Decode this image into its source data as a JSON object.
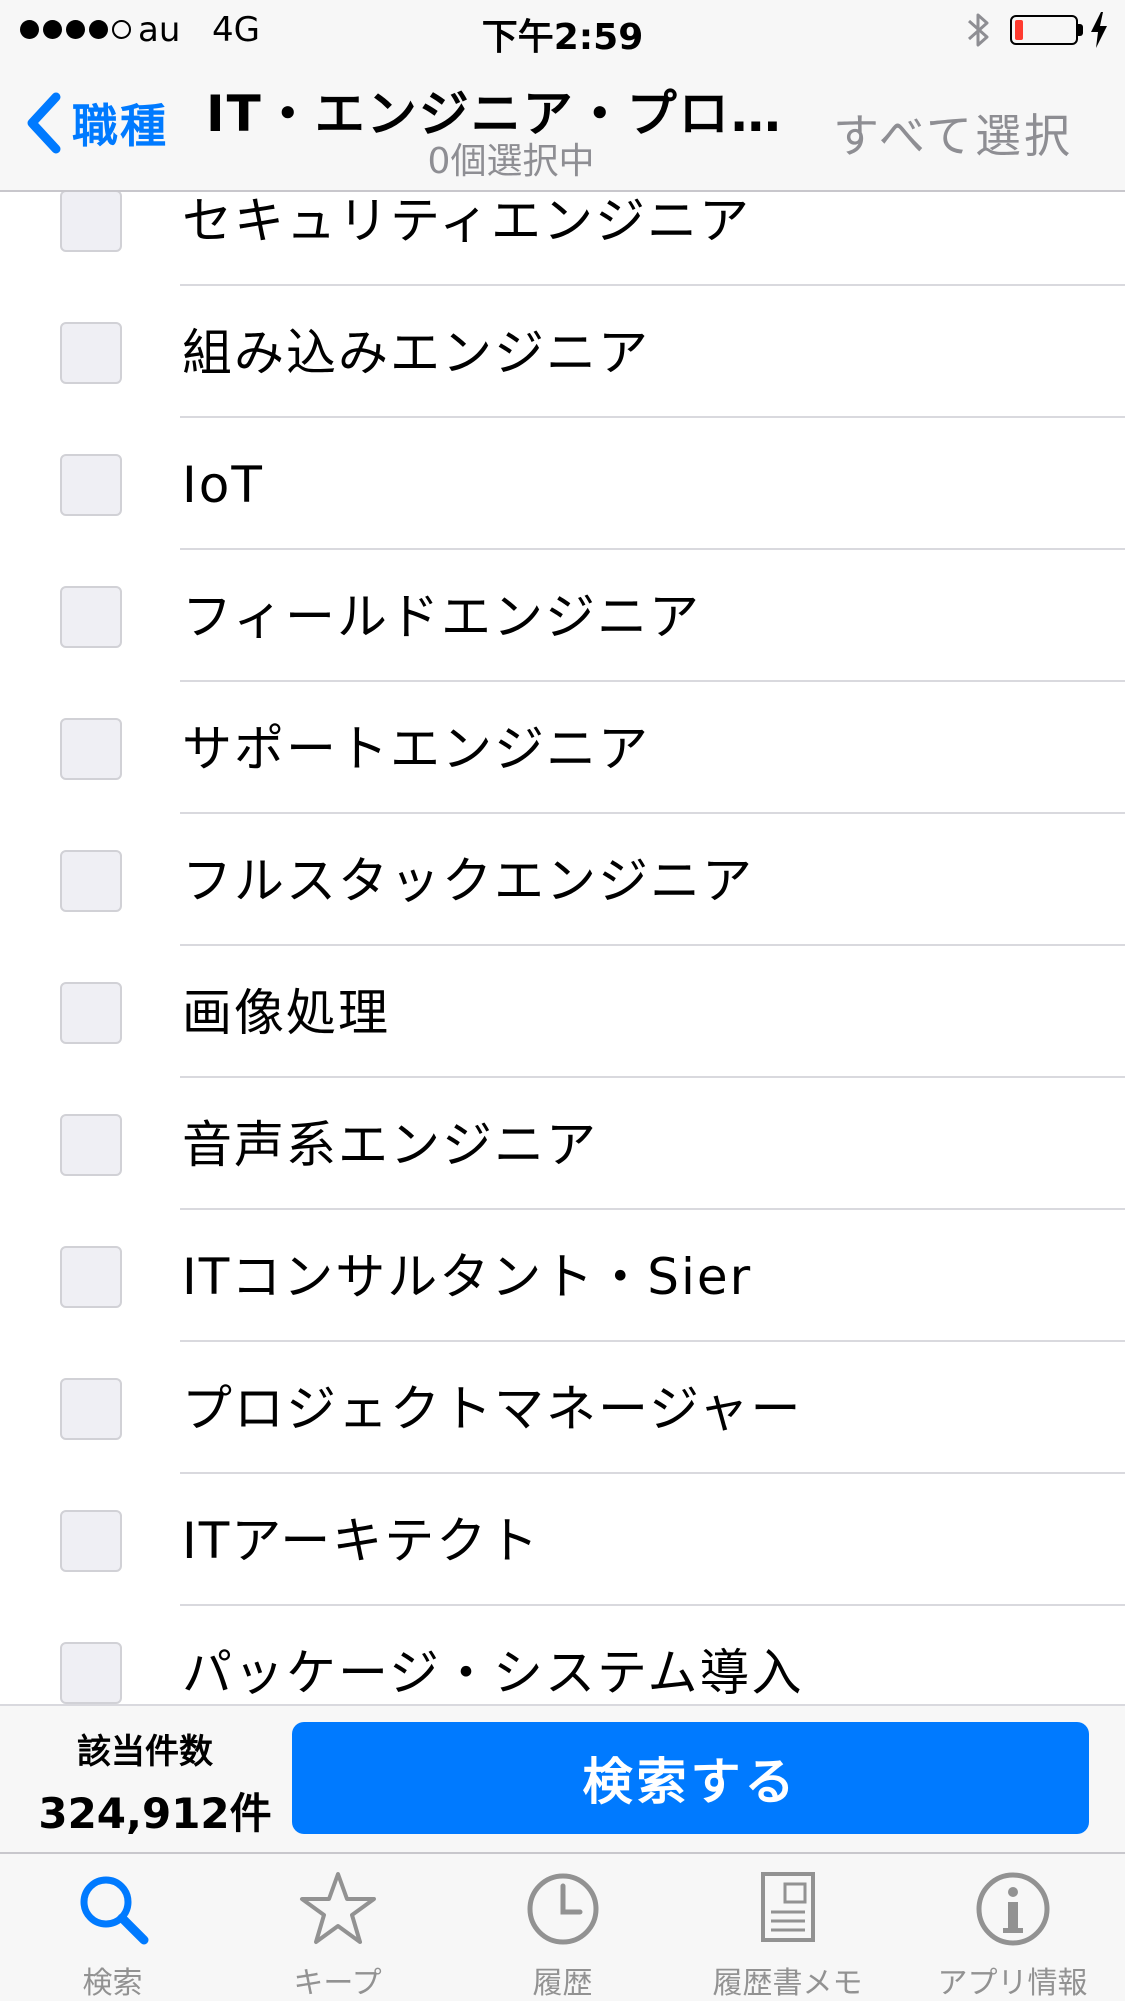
{
  "status_bar": {
    "carrier": "au",
    "network": "4G",
    "time": "下午2:59",
    "battery_color": "#ff3b30"
  },
  "nav": {
    "back_label": "職種",
    "title": "IT・エンジニア・プロ…",
    "subtitle": "0個選択中",
    "action_label": "すべて選択"
  },
  "list": {
    "items": [
      {
        "label": "セキュリティエンジニア",
        "checked": false
      },
      {
        "label": "組み込みエンジニア",
        "checked": false
      },
      {
        "label": "IoT",
        "checked": false
      },
      {
        "label": "フィールドエンジニア",
        "checked": false
      },
      {
        "label": "サポートエンジニア",
        "checked": false
      },
      {
        "label": "フルスタックエンジニア",
        "checked": false
      },
      {
        "label": "画像処理",
        "checked": false
      },
      {
        "label": "音声系エンジニア",
        "checked": false
      },
      {
        "label": "ITコンサルタント・Sier",
        "checked": false
      },
      {
        "label": "プロジェクトマネージャー",
        "checked": false
      },
      {
        "label": "ITアーキテクト",
        "checked": false
      },
      {
        "label": "パッケージ・システム導入",
        "checked": false
      }
    ]
  },
  "search_bar": {
    "count_label": "該当件数",
    "count_value": "324,912件",
    "button_label": "検索する"
  },
  "tabs": [
    {
      "label": "検索",
      "icon": "search-icon",
      "active": true
    },
    {
      "label": "キープ",
      "icon": "star-icon",
      "active": false
    },
    {
      "label": "履歴",
      "icon": "clock-icon",
      "active": false
    },
    {
      "label": "履歴書メモ",
      "icon": "document-icon",
      "active": false
    },
    {
      "label": "アプリ情報",
      "icon": "info-icon",
      "active": false
    }
  ],
  "colors": {
    "accent": "#007aff",
    "tab_inactive": "#929292",
    "bar_background": "#f7f7f7"
  }
}
